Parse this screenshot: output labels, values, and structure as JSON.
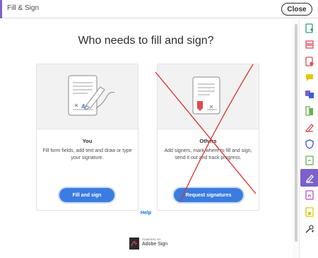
{
  "window": {
    "title": "Fill & Sign",
    "close_label": "Close"
  },
  "main": {
    "heading": "Who needs to fill and sign?",
    "help_label": "Help"
  },
  "cards": {
    "you": {
      "title": "You",
      "description": "Fill form fields, add text and draw or type your signature.",
      "button_label": "Fill and sign"
    },
    "others": {
      "title": "Others",
      "description": "Add signers, mark where to fill and sign, send it out and track progress.",
      "button_label": "Request signatures"
    }
  },
  "footer": {
    "powered_by": "POWERED BY",
    "brand": "Adobe Sign"
  },
  "right_rail": {
    "tools": [
      {
        "icon": "create-pdf-icon",
        "color": "#2d9d78"
      },
      {
        "icon": "organize-pages-icon",
        "color": "#e34850"
      },
      {
        "icon": "export-pdf-icon",
        "color": "#e34850"
      },
      {
        "icon": "comment-icon",
        "color": "#e8c600"
      },
      {
        "icon": "combine-files-icon",
        "color": "#7b61c9"
      },
      {
        "icon": "compare-icon",
        "color": "#6ab04c"
      },
      {
        "icon": "edit-pdf-icon",
        "color": "#e34850"
      },
      {
        "icon": "protect-icon",
        "color": "#3b5bdb"
      },
      {
        "icon": "scan-ocr-icon",
        "color": "#6ab04c"
      },
      {
        "icon": "fill-sign-icon",
        "color": "#ffffff",
        "active": true
      },
      {
        "icon": "send-for-signature-icon",
        "color": "#c04bc0"
      },
      {
        "icon": "action-wizard-icon",
        "color": "#e8c600"
      },
      {
        "icon": "more-tools-icon",
        "color": "#4b4b4b"
      }
    ]
  },
  "colors": {
    "accent": "#7b61c9",
    "primary_button": "#3b7ce0",
    "link": "#1473e6",
    "cross_annotation": "#e0302a"
  }
}
